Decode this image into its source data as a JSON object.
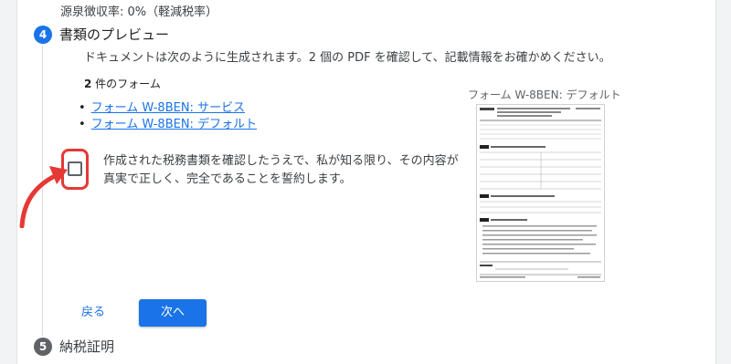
{
  "withholding_rate": "源泉徴収率: 0%（軽減税率）",
  "steps": {
    "step4": {
      "number": "4",
      "title": "書類のプレビュー"
    },
    "step5": {
      "number": "5",
      "title": "納税証明"
    }
  },
  "description": "ドキュメントは次のように生成されます。2 個の PDF を確認して、記載情報をお確かめください。",
  "forms": {
    "count_number": "2",
    "count_suffix": " 件のフォーム",
    "items": [
      {
        "label": "フォーム W-8BEN: サービス"
      },
      {
        "label": "フォーム W-8BEN: デフォルト"
      }
    ]
  },
  "certification": {
    "checked": false,
    "text": "作成された税務書類を確認したうえで、私が知る限り、その内容が真実で正しく、完全であることを誓約します。"
  },
  "preview": {
    "label": "フォーム W-8BEN: デフォルト"
  },
  "buttons": {
    "back": "戻る",
    "next": "次へ"
  },
  "colors": {
    "accent": "#1a73e8",
    "highlight": "#e53935",
    "step_inactive": "#5f6368"
  }
}
